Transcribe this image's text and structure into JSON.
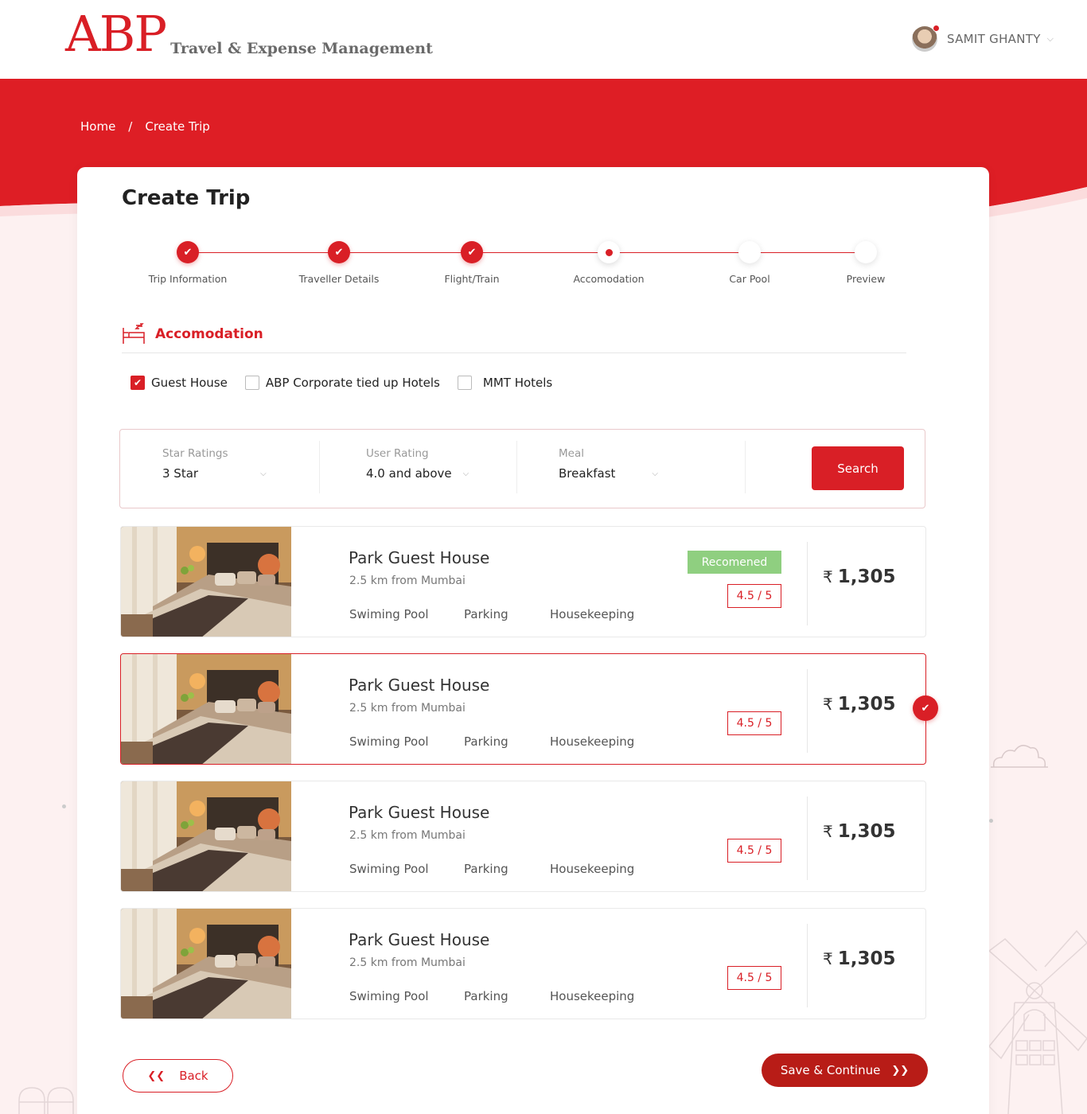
{
  "header": {
    "logo_mark": "ABP",
    "logo_sub": "Travel & Expense Management",
    "user_name": "SAMIT GHANTY"
  },
  "breadcrumb": {
    "home": "Home",
    "separator": "/",
    "current": "Create Trip"
  },
  "page": {
    "title": "Create Trip"
  },
  "stepper": {
    "steps": [
      {
        "label": "Trip Information",
        "state": "done"
      },
      {
        "label": "Traveller Details",
        "state": "done"
      },
      {
        "label": "Flight/Train",
        "state": "done"
      },
      {
        "label": "Accomodation",
        "state": "current"
      },
      {
        "label": "Car Pool",
        "state": "todo"
      },
      {
        "label": "Preview",
        "state": "todo"
      }
    ]
  },
  "section": {
    "icon": "bed-icon",
    "title": "Accomodation"
  },
  "accommodation_types": [
    {
      "label": "Guest House",
      "checked": true
    },
    {
      "label": "ABP Corporate tied up Hotels",
      "checked": false
    },
    {
      "label": "MMT Hotels",
      "checked": false
    }
  ],
  "search": {
    "star_label": "Star Ratings",
    "star_value": "3 Star",
    "user_rating_label": "User Rating",
    "user_rating_value": "4.0 and above",
    "meal_label": "Meal",
    "meal_value": "Breakfast",
    "button": "Search"
  },
  "hotels": [
    {
      "name": "Park Guest House",
      "distance": "2.5 km from Mumbai",
      "amenities": [
        "Swiming Pool",
        "Parking",
        "Housekeeping"
      ],
      "badge": "Recomened",
      "rating": "4.5 / 5",
      "currency": "₹",
      "price": "1,305",
      "selected": false
    },
    {
      "name": "Park Guest House",
      "distance": "2.5 km from Mumbai",
      "amenities": [
        "Swiming Pool",
        "Parking",
        "Housekeeping"
      ],
      "badge": "",
      "rating": "4.5 / 5",
      "currency": "₹",
      "price": "1,305",
      "selected": true
    },
    {
      "name": "Park Guest House",
      "distance": "2.5 km from Mumbai",
      "amenities": [
        "Swiming Pool",
        "Parking",
        "Housekeeping"
      ],
      "badge": "",
      "rating": "4.5 / 5",
      "currency": "₹",
      "price": "1,305",
      "selected": false
    },
    {
      "name": "Park Guest House",
      "distance": "2.5 km from Mumbai",
      "amenities": [
        "Swiming Pool",
        "Parking",
        "Housekeeping"
      ],
      "badge": "",
      "rating": "4.5 / 5",
      "currency": "₹",
      "price": "1,305",
      "selected": false
    }
  ],
  "actions": {
    "back": "Back",
    "save": "Save & Continue"
  },
  "colors": {
    "brand_red": "#d91f26",
    "save_red": "#b81c17",
    "recommended_green": "#8fcf80"
  }
}
